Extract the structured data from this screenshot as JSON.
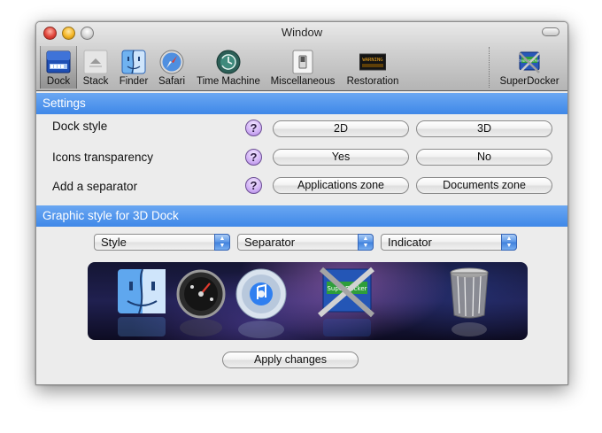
{
  "window": {
    "title": "Window"
  },
  "toolbar": {
    "items": [
      {
        "label": "Dock",
        "icon": "dock-icon",
        "selected": true
      },
      {
        "label": "Stack",
        "icon": "stack-icon"
      },
      {
        "label": "Finder",
        "icon": "finder-icon"
      },
      {
        "label": "Safari",
        "icon": "safari-compass-icon"
      },
      {
        "label": "Time Machine",
        "icon": "time-machine-icon"
      },
      {
        "label": "Miscellaneous",
        "icon": "switch-icon"
      },
      {
        "label": "Restoration",
        "icon": "warning-display-icon"
      },
      {
        "label": "SuperDocker",
        "icon": "superdocker-tools-icon"
      }
    ]
  },
  "settings": {
    "title": "Settings",
    "help_symbol": "?",
    "rows": [
      {
        "label": "Dock style",
        "options": [
          "2D",
          "3D"
        ]
      },
      {
        "label": "Icons transparency",
        "options": [
          "Yes",
          "No"
        ]
      },
      {
        "label": "Add a separator",
        "options": [
          "Applications zone",
          "Documents zone"
        ]
      }
    ]
  },
  "graphic_style": {
    "title": "Graphic style for 3D Dock",
    "popups": [
      {
        "value": "Style"
      },
      {
        "value": "Separator"
      },
      {
        "value": "Indicator"
      }
    ],
    "preview_icons": [
      "finder-face-icon",
      "dashboard-gauge-icon",
      "itunes-cd-icon",
      "superdocker-tools-icon",
      "trash-can-icon"
    ],
    "icon_display_text": {
      "restoration": "WARNING",
      "superdocker": "SuperDocker"
    }
  },
  "apply_label": "Apply changes",
  "colors": {
    "section_header": "#4a8fec",
    "help_button": "#c9a6f2"
  }
}
